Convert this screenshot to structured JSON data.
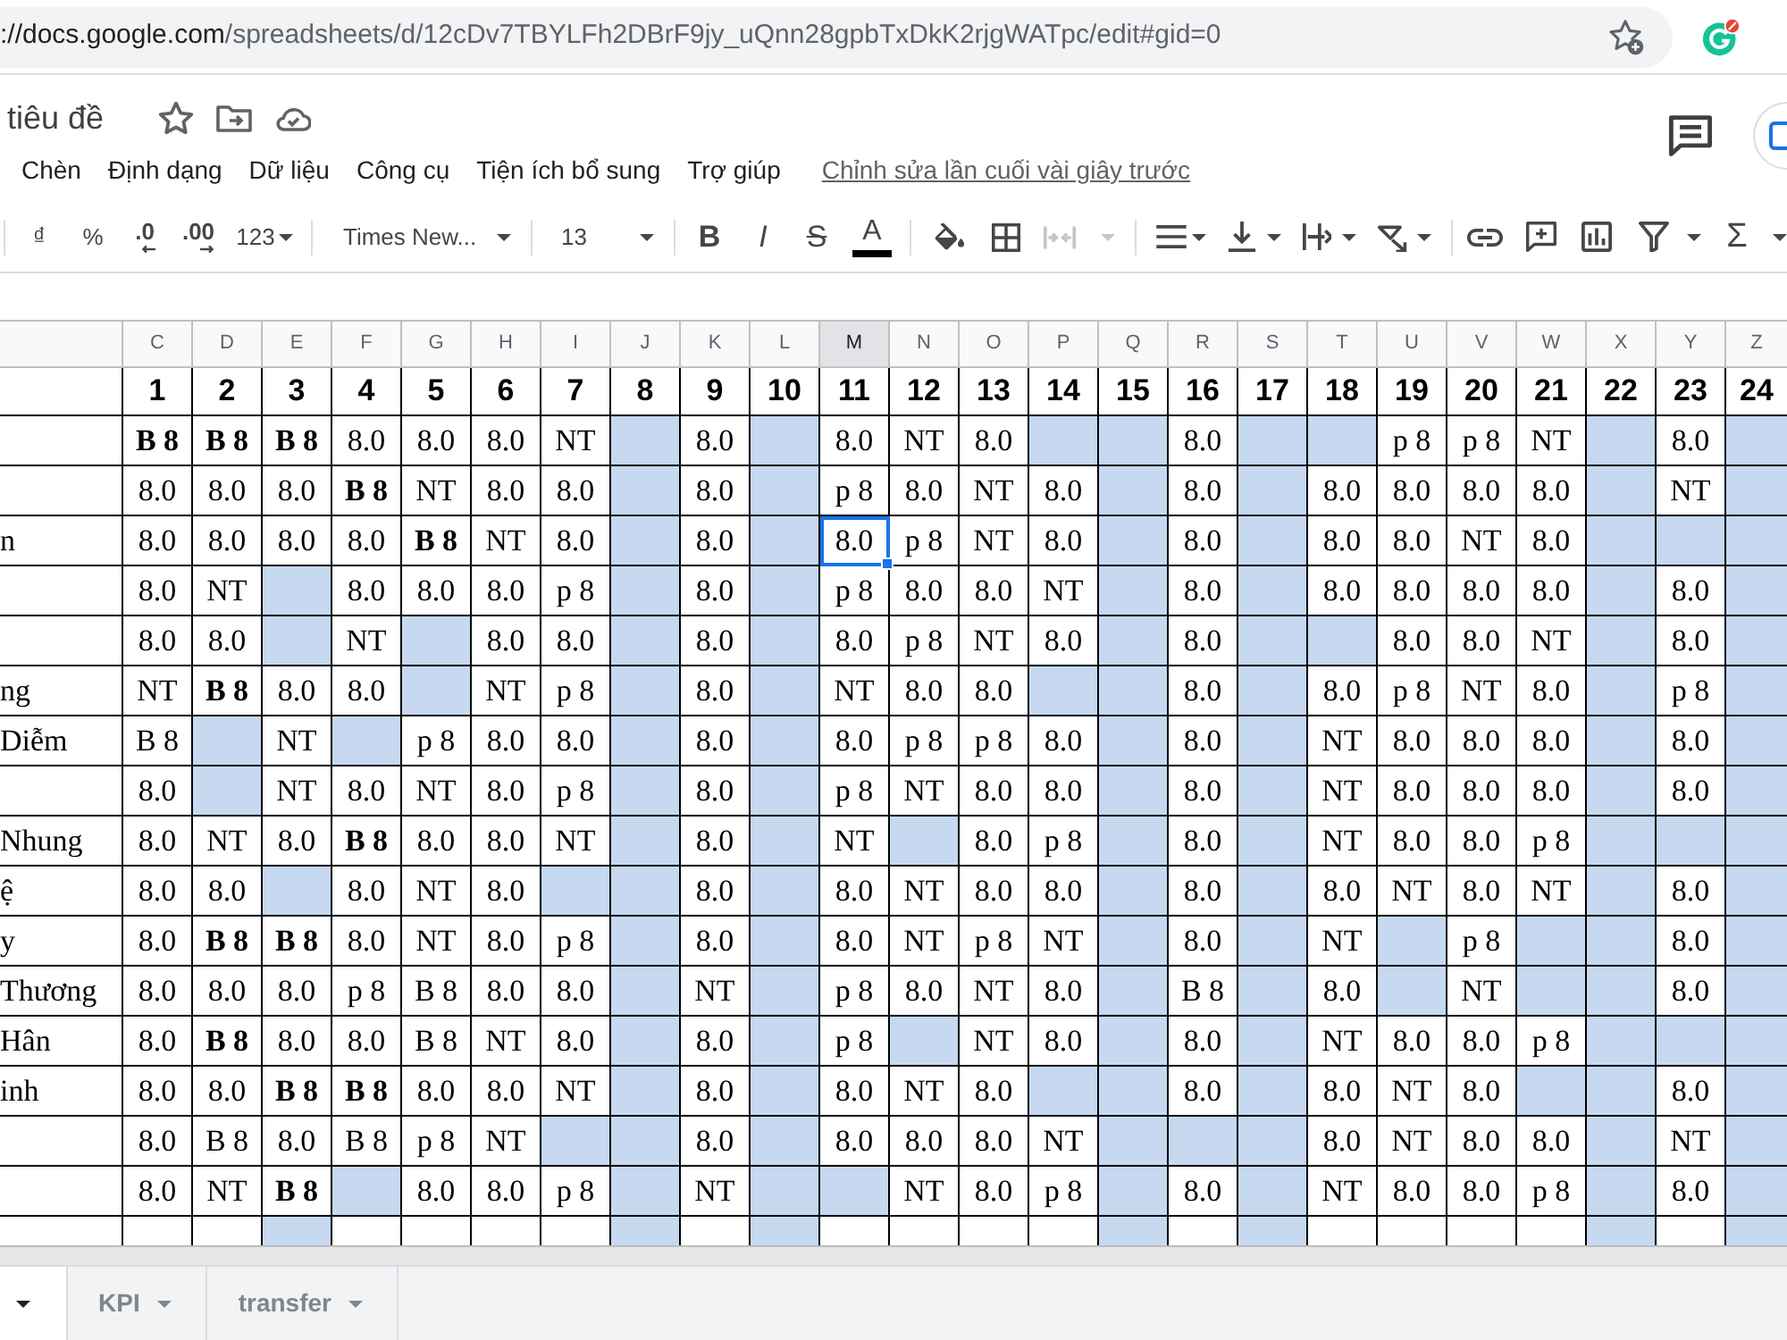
{
  "browser": {
    "url_host": "://docs.google.com",
    "url_path": "/spreadsheets/d/12cDv7TBYLFh2DBrF9jy_uQnn28gpbTxDkK2rjgWATpc/edit#gid=0"
  },
  "document": {
    "title": "tiêu đề"
  },
  "menu": [
    "Chèn",
    "Định dạng",
    "Dữ liệu",
    "Công cụ",
    "Tiện ích bổ sung",
    "Trợ giúp"
  ],
  "last_edit": "Chỉnh sửa lần cuối vài giây trước",
  "toolbar": {
    "currency": "₫",
    "percent": "%",
    "decimal_decrease": ".0",
    "decimal_increase": ".00",
    "number_format": "123",
    "font": "Times New...",
    "font_size": "13",
    "bold": "B",
    "italic": "I",
    "strikethrough": "S",
    "text_color": "A",
    "merge": {
      "disabled": true
    },
    "functions": "Σ"
  },
  "sheet": {
    "columns": [
      {
        "label": "C",
        "selected": false
      },
      {
        "label": "D",
        "selected": false
      },
      {
        "label": "E",
        "selected": false
      },
      {
        "label": "F",
        "selected": false
      },
      {
        "label": "G",
        "selected": false
      },
      {
        "label": "H",
        "selected": false
      },
      {
        "label": "I",
        "selected": false
      },
      {
        "label": "J",
        "selected": false
      },
      {
        "label": "K",
        "selected": false
      },
      {
        "label": "L",
        "selected": false
      },
      {
        "label": "M",
        "selected": true
      },
      {
        "label": "N",
        "selected": false
      },
      {
        "label": "O",
        "selected": false
      },
      {
        "label": "P",
        "selected": false
      },
      {
        "label": "Q",
        "selected": false
      },
      {
        "label": "R",
        "selected": false
      },
      {
        "label": "S",
        "selected": false
      },
      {
        "label": "T",
        "selected": false
      },
      {
        "label": "U",
        "selected": false
      },
      {
        "label": "V",
        "selected": false
      },
      {
        "label": "W",
        "selected": false
      },
      {
        "label": "X",
        "selected": false
      },
      {
        "label": "Y",
        "selected": false
      },
      {
        "label": "Z",
        "selected": false
      }
    ],
    "header_row": [
      "1",
      "2",
      "3",
      "4",
      "5",
      "6",
      "7",
      "8",
      "9",
      "10",
      "11",
      "12",
      "13",
      "14",
      "15",
      "16",
      "17",
      "18",
      "19",
      "20",
      "21",
      "22",
      "23",
      "24"
    ],
    "rows": [
      {
        "selected": false,
        "cells": [
          {
            "text": "B 8",
            "bold": true
          },
          {
            "text": "B 8",
            "bold": true
          },
          {
            "text": "B 8",
            "bold": true
          },
          {
            "text": "8.0",
            "bold": false
          },
          {
            "text": "8.0",
            "bold": false
          },
          {
            "text": "8.0",
            "bold": false
          },
          {
            "text": "NT",
            "bold": false
          },
          null,
          {
            "text": "8.0",
            "bold": false
          },
          null,
          {
            "text": "8.0",
            "bold": false
          },
          {
            "text": "NT",
            "bold": false
          },
          {
            "text": "8.0",
            "bold": false
          },
          null,
          null,
          {
            "text": "8.0",
            "bold": false
          },
          null,
          null,
          {
            "text": "p 8",
            "bold": false
          },
          {
            "text": "p 8",
            "bold": false
          },
          {
            "text": "NT",
            "bold": false
          },
          null,
          {
            "text": "8.0",
            "bold": false
          },
          null
        ]
      },
      {
        "selected": false,
        "cells": [
          {
            "text": "8.0",
            "bold": false
          },
          {
            "text": "8.0",
            "bold": false
          },
          {
            "text": "8.0",
            "bold": false
          },
          {
            "text": "B 8",
            "bold": true
          },
          {
            "text": "NT",
            "bold": false
          },
          {
            "text": "8.0",
            "bold": false
          },
          {
            "text": "8.0",
            "bold": false
          },
          null,
          {
            "text": "8.0",
            "bold": false
          },
          null,
          {
            "text": "p 8",
            "bold": false
          },
          {
            "text": "8.0",
            "bold": false
          },
          {
            "text": "NT",
            "bold": false
          },
          {
            "text": "8.0",
            "bold": false
          },
          null,
          {
            "text": "8.0",
            "bold": false
          },
          null,
          {
            "text": "8.0",
            "bold": false
          },
          {
            "text": "8.0",
            "bold": false
          },
          {
            "text": "8.0",
            "bold": false
          },
          {
            "text": "8.0",
            "bold": false
          },
          null,
          {
            "text": "NT",
            "bold": false
          },
          null
        ]
      },
      {
        "name": "n",
        "selected": true,
        "cells": [
          {
            "text": "8.0",
            "bold": false
          },
          {
            "text": "8.0",
            "bold": false
          },
          {
            "text": "8.0",
            "bold": false
          },
          {
            "text": "8.0",
            "bold": false
          },
          {
            "text": "B 8",
            "bold": true
          },
          {
            "text": "NT",
            "bold": false
          },
          {
            "text": "8.0",
            "bold": false
          },
          null,
          {
            "text": "8.0",
            "bold": false
          },
          null,
          {
            "text": "8.0",
            "bold": false
          },
          {
            "text": "p 8",
            "bold": false
          },
          {
            "text": "NT",
            "bold": false
          },
          {
            "text": "8.0",
            "bold": false
          },
          null,
          {
            "text": "8.0",
            "bold": false
          },
          null,
          {
            "text": "8.0",
            "bold": false
          },
          {
            "text": "8.0",
            "bold": false
          },
          {
            "text": "NT",
            "bold": false
          },
          {
            "text": "8.0",
            "bold": false
          },
          null,
          null,
          null
        ]
      },
      {
        "selected": false,
        "cells": [
          {
            "text": "8.0",
            "bold": false
          },
          {
            "text": "NT",
            "bold": false
          },
          null,
          {
            "text": "8.0",
            "bold": false
          },
          {
            "text": "8.0",
            "bold": false
          },
          {
            "text": "8.0",
            "bold": false
          },
          {
            "text": "p 8",
            "bold": false
          },
          null,
          {
            "text": "8.0",
            "bold": false
          },
          null,
          {
            "text": "p 8",
            "bold": false
          },
          {
            "text": "8.0",
            "bold": false
          },
          {
            "text": "8.0",
            "bold": false
          },
          {
            "text": "NT",
            "bold": false
          },
          null,
          {
            "text": "8.0",
            "bold": false
          },
          null,
          {
            "text": "8.0",
            "bold": false
          },
          {
            "text": "8.0",
            "bold": false
          },
          {
            "text": "8.0",
            "bold": false
          },
          {
            "text": "8.0",
            "bold": false
          },
          null,
          {
            "text": "8.0",
            "bold": false
          },
          null
        ]
      },
      {
        "selected": false,
        "cells": [
          {
            "text": "8.0",
            "bold": false
          },
          {
            "text": "8.0",
            "bold": false
          },
          null,
          {
            "text": "NT",
            "bold": false
          },
          null,
          {
            "text": "8.0",
            "bold": false
          },
          {
            "text": "8.0",
            "bold": false
          },
          null,
          {
            "text": "8.0",
            "bold": false
          },
          null,
          {
            "text": "8.0",
            "bold": false
          },
          {
            "text": "p 8",
            "bold": false
          },
          {
            "text": "NT",
            "bold": false
          },
          {
            "text": "8.0",
            "bold": false
          },
          null,
          {
            "text": "8.0",
            "bold": false
          },
          null,
          null,
          {
            "text": "8.0",
            "bold": false
          },
          {
            "text": "8.0",
            "bold": false
          },
          {
            "text": "NT",
            "bold": false
          },
          null,
          {
            "text": "8.0",
            "bold": false
          },
          null
        ]
      },
      {
        "name": "ng",
        "selected": false,
        "cells": [
          {
            "text": "NT",
            "bold": false
          },
          {
            "text": "B 8",
            "bold": true
          },
          {
            "text": "8.0",
            "bold": false
          },
          {
            "text": "8.0",
            "bold": false
          },
          null,
          {
            "text": "NT",
            "bold": false
          },
          {
            "text": "p 8",
            "bold": false
          },
          null,
          {
            "text": "8.0",
            "bold": false
          },
          null,
          {
            "text": "NT",
            "bold": false
          },
          {
            "text": "8.0",
            "bold": false
          },
          {
            "text": "8.0",
            "bold": false
          },
          null,
          null,
          {
            "text": "8.0",
            "bold": false
          },
          null,
          {
            "text": "8.0",
            "bold": false
          },
          {
            "text": "p 8",
            "bold": false
          },
          {
            "text": "NT",
            "bold": false
          },
          {
            "text": "8.0",
            "bold": false
          },
          null,
          {
            "text": "p 8",
            "bold": false
          },
          null
        ]
      },
      {
        "name": "Diễm",
        "selected": false,
        "cells": [
          {
            "text": "B 8",
            "bold": false
          },
          null,
          {
            "text": "NT",
            "bold": false
          },
          null,
          {
            "text": "p 8",
            "bold": false
          },
          {
            "text": "8.0",
            "bold": false
          },
          {
            "text": "8.0",
            "bold": false
          },
          null,
          {
            "text": "8.0",
            "bold": false
          },
          null,
          {
            "text": "8.0",
            "bold": false
          },
          {
            "text": "p 8",
            "bold": false
          },
          {
            "text": "p 8",
            "bold": false
          },
          {
            "text": "8.0",
            "bold": false
          },
          null,
          {
            "text": "8.0",
            "bold": false
          },
          null,
          {
            "text": "NT",
            "bold": false
          },
          {
            "text": "8.0",
            "bold": false
          },
          {
            "text": "8.0",
            "bold": false
          },
          {
            "text": "8.0",
            "bold": false
          },
          null,
          {
            "text": "8.0",
            "bold": false
          },
          null
        ]
      },
      {
        "selected": false,
        "cells": [
          {
            "text": "8.0",
            "bold": false
          },
          null,
          {
            "text": "NT",
            "bold": false
          },
          {
            "text": "8.0",
            "bold": false
          },
          {
            "text": "NT",
            "bold": false
          },
          {
            "text": "8.0",
            "bold": false
          },
          {
            "text": "p 8",
            "bold": false
          },
          null,
          {
            "text": "8.0",
            "bold": false
          },
          null,
          {
            "text": "p 8",
            "bold": false
          },
          {
            "text": "NT",
            "bold": false
          },
          {
            "text": "8.0",
            "bold": false
          },
          {
            "text": "8.0",
            "bold": false
          },
          null,
          {
            "text": "8.0",
            "bold": false
          },
          null,
          {
            "text": "NT",
            "bold": false
          },
          {
            "text": "8.0",
            "bold": false
          },
          {
            "text": "8.0",
            "bold": false
          },
          {
            "text": "8.0",
            "bold": false
          },
          null,
          {
            "text": "8.0",
            "bold": false
          },
          null
        ]
      },
      {
        "name": "Nhung",
        "selected": false,
        "cells": [
          {
            "text": "8.0",
            "bold": false
          },
          {
            "text": "NT",
            "bold": false
          },
          {
            "text": "8.0",
            "bold": false
          },
          {
            "text": "B 8",
            "bold": true
          },
          {
            "text": "8.0",
            "bold": false
          },
          {
            "text": "8.0",
            "bold": false
          },
          {
            "text": "NT",
            "bold": false
          },
          null,
          {
            "text": "8.0",
            "bold": false
          },
          null,
          {
            "text": "NT",
            "bold": false
          },
          null,
          {
            "text": "8.0",
            "bold": false
          },
          {
            "text": "p 8",
            "bold": false
          },
          null,
          {
            "text": "8.0",
            "bold": false
          },
          null,
          {
            "text": "NT",
            "bold": false
          },
          {
            "text": "8.0",
            "bold": false
          },
          {
            "text": "8.0",
            "bold": false
          },
          {
            "text": "p 8",
            "bold": false
          },
          null,
          null,
          null
        ]
      },
      {
        "name": "ệ",
        "selected": false,
        "cells": [
          {
            "text": "8.0",
            "bold": false
          },
          {
            "text": "8.0",
            "bold": false
          },
          null,
          {
            "text": "8.0",
            "bold": false
          },
          {
            "text": "NT",
            "bold": false
          },
          {
            "text": "8.0",
            "bold": false
          },
          null,
          null,
          {
            "text": "8.0",
            "bold": false
          },
          null,
          {
            "text": "8.0",
            "bold": false
          },
          {
            "text": "NT",
            "bold": false
          },
          {
            "text": "8.0",
            "bold": false
          },
          {
            "text": "8.0",
            "bold": false
          },
          null,
          {
            "text": "8.0",
            "bold": false
          },
          null,
          {
            "text": "8.0",
            "bold": false
          },
          {
            "text": "NT",
            "bold": false
          },
          {
            "text": "8.0",
            "bold": false
          },
          {
            "text": "NT",
            "bold": false
          },
          null,
          {
            "text": "8.0",
            "bold": false
          },
          null
        ]
      },
      {
        "name": "y",
        "selected": false,
        "cells": [
          {
            "text": "8.0",
            "bold": false
          },
          {
            "text": "B 8",
            "bold": true
          },
          {
            "text": "B 8",
            "bold": true
          },
          {
            "text": "8.0",
            "bold": false
          },
          {
            "text": "NT",
            "bold": false
          },
          {
            "text": "8.0",
            "bold": false
          },
          {
            "text": "p 8",
            "bold": false
          },
          null,
          {
            "text": "8.0",
            "bold": false
          },
          null,
          {
            "text": "8.0",
            "bold": false
          },
          {
            "text": "NT",
            "bold": false
          },
          {
            "text": "p 8",
            "bold": false
          },
          {
            "text": "NT",
            "bold": false
          },
          null,
          {
            "text": "8.0",
            "bold": false
          },
          null,
          {
            "text": "NT",
            "bold": false
          },
          null,
          {
            "text": "p 8",
            "bold": false
          },
          null,
          null,
          {
            "text": "8.0",
            "bold": false
          },
          null
        ]
      },
      {
        "name": "Thương",
        "selected": false,
        "cells": [
          {
            "text": "8.0",
            "bold": false
          },
          {
            "text": "8.0",
            "bold": false
          },
          {
            "text": "8.0",
            "bold": false
          },
          {
            "text": "p 8",
            "bold": false
          },
          {
            "text": "B 8",
            "bold": false
          },
          {
            "text": "8.0",
            "bold": false
          },
          {
            "text": "8.0",
            "bold": false
          },
          null,
          {
            "text": "NT",
            "bold": false
          },
          null,
          {
            "text": "p 8",
            "bold": false
          },
          {
            "text": "8.0",
            "bold": false
          },
          {
            "text": "NT",
            "bold": false
          },
          {
            "text": "8.0",
            "bold": false
          },
          null,
          {
            "text": "B 8",
            "bold": false
          },
          null,
          {
            "text": "8.0",
            "bold": false
          },
          null,
          {
            "text": "NT",
            "bold": false
          },
          null,
          null,
          {
            "text": "8.0",
            "bold": false
          },
          null
        ]
      },
      {
        "name": "Hân",
        "selected": false,
        "cells": [
          {
            "text": "8.0",
            "bold": false
          },
          {
            "text": "B 8",
            "bold": true
          },
          {
            "text": "8.0",
            "bold": false
          },
          {
            "text": "8.0",
            "bold": false
          },
          {
            "text": "B 8",
            "bold": false
          },
          {
            "text": "NT",
            "bold": false
          },
          {
            "text": "8.0",
            "bold": false
          },
          null,
          {
            "text": "8.0",
            "bold": false
          },
          null,
          {
            "text": "p 8",
            "bold": false
          },
          null,
          {
            "text": "NT",
            "bold": false
          },
          {
            "text": "8.0",
            "bold": false
          },
          null,
          {
            "text": "8.0",
            "bold": false
          },
          null,
          {
            "text": "NT",
            "bold": false
          },
          {
            "text": "8.0",
            "bold": false
          },
          {
            "text": "8.0",
            "bold": false
          },
          {
            "text": "p 8",
            "bold": false
          },
          null,
          null,
          null
        ]
      },
      {
        "name": "inh",
        "selected": false,
        "cells": [
          {
            "text": "8.0",
            "bold": false
          },
          {
            "text": "8.0",
            "bold": false
          },
          {
            "text": "B 8",
            "bold": true
          },
          {
            "text": "B 8",
            "bold": true
          },
          {
            "text": "8.0",
            "bold": false
          },
          {
            "text": "8.0",
            "bold": false
          },
          {
            "text": "NT",
            "bold": false
          },
          null,
          {
            "text": "8.0",
            "bold": false
          },
          null,
          {
            "text": "8.0",
            "bold": false
          },
          {
            "text": "NT",
            "bold": false
          },
          {
            "text": "8.0",
            "bold": false
          },
          null,
          null,
          {
            "text": "8.0",
            "bold": false
          },
          null,
          {
            "text": "8.0",
            "bold": false
          },
          {
            "text": "NT",
            "bold": false
          },
          {
            "text": "8.0",
            "bold": false
          },
          null,
          null,
          {
            "text": "8.0",
            "bold": false
          },
          null
        ]
      },
      {
        "selected": false,
        "cells": [
          {
            "text": "8.0",
            "bold": false
          },
          {
            "text": "B 8",
            "bold": false
          },
          {
            "text": "8.0",
            "bold": false
          },
          {
            "text": "B 8",
            "bold": false
          },
          {
            "text": "p 8",
            "bold": false
          },
          {
            "text": "NT",
            "bold": false
          },
          null,
          null,
          {
            "text": "8.0",
            "bold": false
          },
          null,
          {
            "text": "8.0",
            "bold": false
          },
          {
            "text": "8.0",
            "bold": false
          },
          {
            "text": "8.0",
            "bold": false
          },
          {
            "text": "NT",
            "bold": false
          },
          null,
          null,
          null,
          {
            "text": "8.0",
            "bold": false
          },
          {
            "text": "NT",
            "bold": false
          },
          {
            "text": "8.0",
            "bold": false
          },
          {
            "text": "8.0",
            "bold": false
          },
          null,
          {
            "text": "NT",
            "bold": false
          },
          null
        ]
      },
      {
        "selected": false,
        "cells": [
          {
            "text": "8.0",
            "bold": false
          },
          {
            "text": "NT",
            "bold": false
          },
          {
            "text": "B 8",
            "bold": true
          },
          null,
          {
            "text": "8.0",
            "bold": false
          },
          {
            "text": "8.0",
            "bold": false
          },
          {
            "text": "p 8",
            "bold": false
          },
          null,
          {
            "text": "NT",
            "bold": false
          },
          null,
          null,
          {
            "text": "NT",
            "bold": false
          },
          {
            "text": "8.0",
            "bold": false
          },
          {
            "text": "p 8",
            "bold": false
          },
          null,
          {
            "text": "8.0",
            "bold": false
          },
          null,
          {
            "text": "NT",
            "bold": false
          },
          {
            "text": "8.0",
            "bold": false
          },
          {
            "text": "8.0",
            "bold": false
          },
          {
            "text": "p 8",
            "bold": false
          },
          null,
          {
            "text": "8.0",
            "bold": false
          },
          null
        ]
      }
    ],
    "cut_row": {
      "blank": [
        false,
        false,
        true,
        false,
        false,
        false,
        false,
        true,
        false,
        true,
        false,
        false,
        false,
        false,
        true,
        false,
        true,
        false,
        false,
        false,
        false,
        true,
        false,
        true
      ]
    }
  },
  "sheet_tabs": [
    {
      "selected": true
    },
    {
      "label": "KPI",
      "selected": false
    },
    {
      "label": "transfer",
      "selected": false
    }
  ]
}
